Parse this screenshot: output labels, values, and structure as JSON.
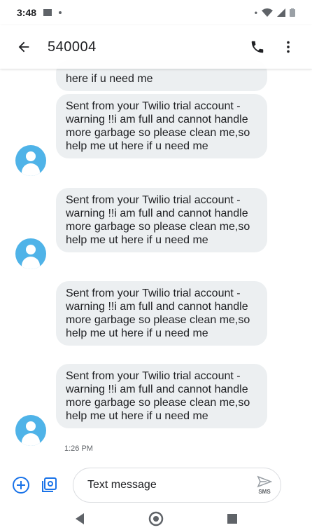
{
  "status_bar": {
    "time": "3:48"
  },
  "header": {
    "title": "540004"
  },
  "messages": [
    {
      "text": "here if u need me",
      "partial": true
    },
    {
      "text": "Sent from your Twilio trial account - warning !!i am full and cannot handle more garbage so please clean me,so help me ut here if u need me"
    },
    {
      "text": "Sent from your Twilio trial account - warning !!i am full and cannot handle more garbage so please clean me,so help me ut here if u need me"
    },
    {
      "text": "Sent from your Twilio trial account - warning !!i am full and cannot handle more garbage so please clean me,so help me ut here if u need me"
    },
    {
      "text": "Sent from your Twilio trial account - warning !!i am full and cannot handle more garbage so please clean me,so help me ut here if u need me"
    }
  ],
  "timestamp": "1:26 PM",
  "compose": {
    "placeholder": "Text message",
    "send_sub_label": "SMS"
  },
  "colors": {
    "accent": "#1a73e8",
    "avatar": "#4fb3e8",
    "bubble": "#eceff1"
  }
}
